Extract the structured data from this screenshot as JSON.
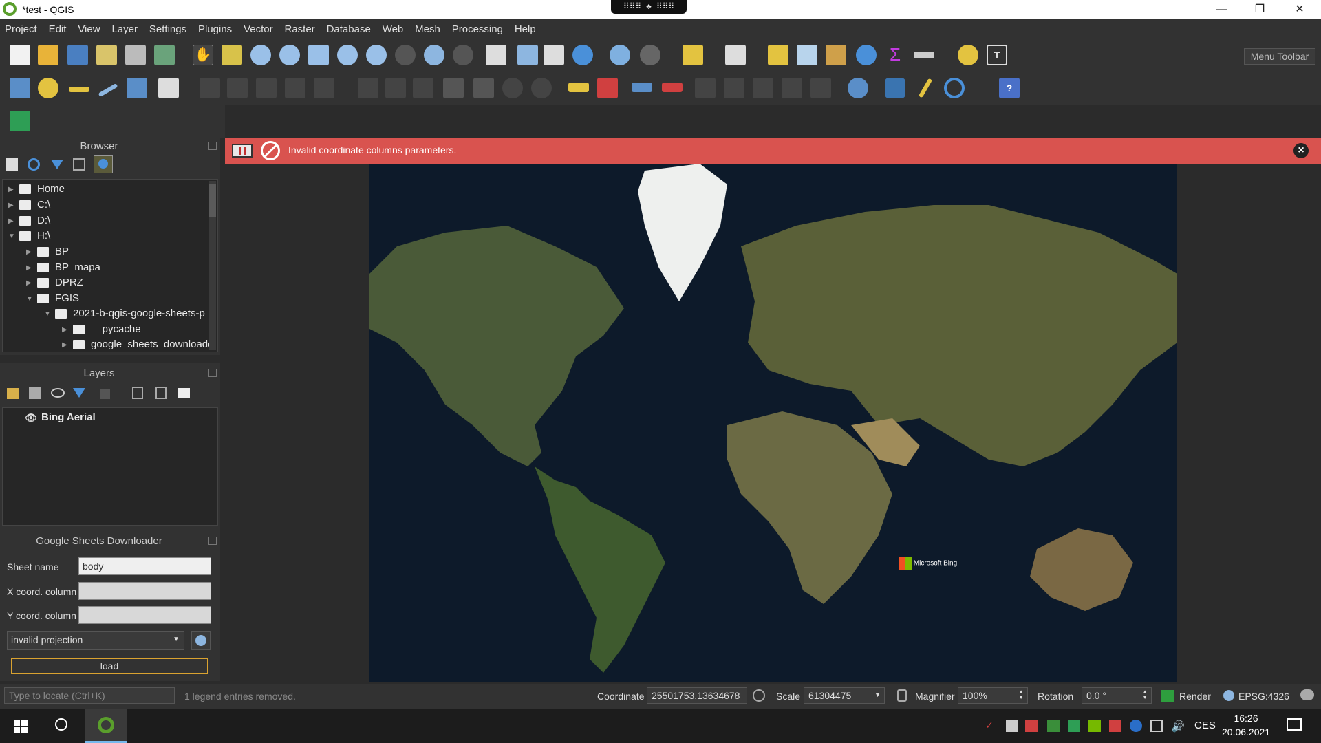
{
  "window": {
    "title": "*test - QGIS"
  },
  "menu": [
    "Project",
    "Edit",
    "View",
    "Layer",
    "Settings",
    "Plugins",
    "Vector",
    "Raster",
    "Database",
    "Web",
    "Mesh",
    "Processing",
    "Help"
  ],
  "menu_toolbar_label": "Menu Toolbar",
  "browser": {
    "title": "Browser",
    "items": [
      "Home",
      "C:\\",
      "D:\\",
      "H:\\",
      "BP",
      "BP_mapa",
      "DPRZ",
      "FGIS",
      "2021-b-qgis-google-sheets-p",
      "__pycache__",
      "google_sheets_downloade"
    ]
  },
  "layers": {
    "title": "Layers",
    "items": [
      "Bing Aerial"
    ]
  },
  "alert": {
    "message": "Invalid coordinate columns parameters."
  },
  "map": {
    "attribution": "Microsoft Bing"
  },
  "plugin": {
    "title": "Google Sheets Downloader",
    "sheet_label": "Sheet name",
    "sheet_value": "body",
    "x_label": "X coord. column",
    "x_value": "",
    "y_label": "Y coord. column",
    "y_value": "",
    "projection": "invalid projection",
    "load_label": "load"
  },
  "status": {
    "locate_placeholder": "Type to locate (Ctrl+K)",
    "message": "1 legend entries removed.",
    "coordinate_label": "Coordinate",
    "coordinate_value": "25501753,13634678",
    "scale_label": "Scale",
    "scale_value": "61304475",
    "magnifier_label": "Magnifier",
    "magnifier_value": "100%",
    "rotation_label": "Rotation",
    "rotation_value": "0.0 °",
    "render_label": "Render",
    "crs": "EPSG:4326"
  },
  "taskbar": {
    "lang": "CES",
    "time": "16:26",
    "date": "20.06.2021"
  },
  "colors": {
    "alert": "#d9534f",
    "qgis_green": "#5a9e2c",
    "panel": "#323232"
  }
}
